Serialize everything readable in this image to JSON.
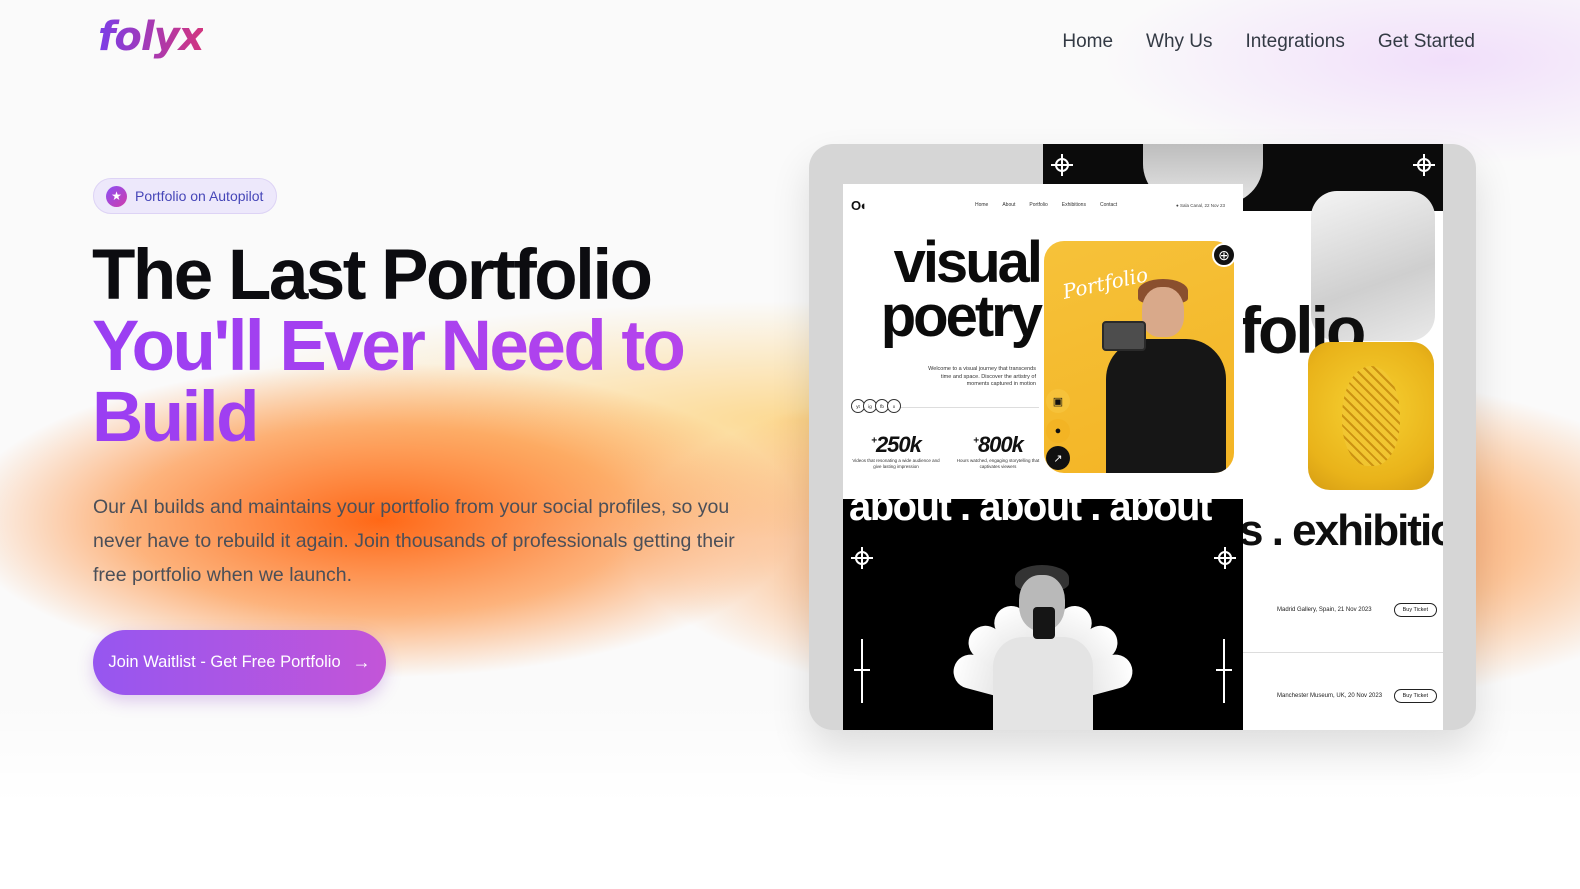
{
  "brand": {
    "logo": "folyx"
  },
  "nav": {
    "items": [
      {
        "label": "Home"
      },
      {
        "label": "Why Us"
      },
      {
        "label": "Integrations"
      },
      {
        "label": "Get Started"
      }
    ]
  },
  "hero": {
    "badge": "Portfolio on Autopilot",
    "title_line1": "The Last Portfolio",
    "title_line2": "You'll Ever Need to Build",
    "subtitle": "Our AI builds and maintains your portfolio from your social profiles, so you never have to rebuild it again. Join thousands of professionals getting their free portfolio when we launch.",
    "cta_label": "Join Waitlist - Get Free Portfolio",
    "cta_icon": "arrow-right-icon"
  },
  "mockup": {
    "front": {
      "logo": "O◖",
      "nav_links": [
        "Home",
        "About",
        "Portfolio",
        "Exhibitions",
        "Contact"
      ],
      "meta": "● Sala Canal, 22 Nov 23",
      "title_line1": "visual",
      "title_line2": "poetry",
      "description": "Welcome to a visual journey that transcends time and space. Discover the artistry of moments captured in motion",
      "socials": [
        "yt",
        "ig",
        "fb",
        "x"
      ],
      "stats": [
        {
          "prefix": "+",
          "value": "250k",
          "caption": "Videos that resonating a wide audience and give lasting impression"
        },
        {
          "prefix": "+",
          "value": "800k",
          "caption": "Hours watched, engaging storytelling that captivates viewers"
        }
      ],
      "signature": "Portfolio",
      "about_band": "about . about . about"
    },
    "back": {
      "title_fragment": "folio",
      "exhibition_band": "s . exhibition",
      "rows": [
        {
          "venue": "Madrid Gallery, Spain, 21 Nov 2023",
          "button": "Buy Ticket"
        },
        {
          "venue": "Manchester Museum, UK, 20 Nov 2023",
          "button": "Buy Ticket"
        }
      ]
    }
  },
  "colors": {
    "accent_purple": "#9a3ef2",
    "logo_gradient_start": "#7a3ee8",
    "logo_gradient_end": "#d2357f",
    "glow_orange": "#ff600a",
    "mock_yellow": "#f6c23a"
  }
}
